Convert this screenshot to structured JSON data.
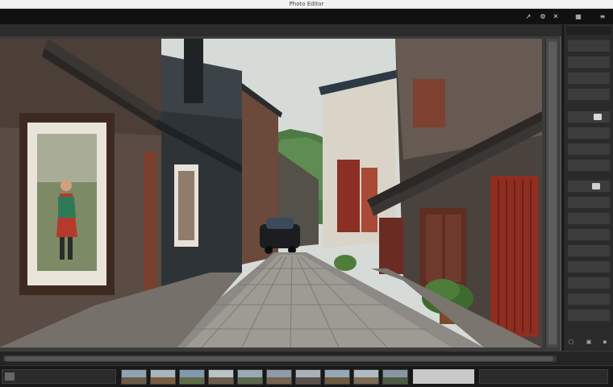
{
  "window": {
    "title": "Photo Editor"
  },
  "menubar": {
    "items": [],
    "controls": [
      "arrow-icon",
      "settings-icon",
      "close-icon",
      "grid-icon",
      "menu-icon"
    ]
  },
  "toolbar": {
    "items": []
  },
  "filmstrip": {
    "thumbnail_count": 10,
    "thumbnails": [
      {
        "sky": "#8fa3b4",
        "land": "#6b5a46"
      },
      {
        "sky": "#a7b5be",
        "land": "#7a5c3c"
      },
      {
        "sky": "#7f99ad",
        "land": "#5f6b45"
      },
      {
        "sky": "#b9c2c7",
        "land": "#6e5b4b"
      },
      {
        "sky": "#9aa9b3",
        "land": "#58664a"
      },
      {
        "sky": "#8c9ba6",
        "land": "#77624d"
      },
      {
        "sky": "#a8b3b9",
        "land": "#5a5048"
      },
      {
        "sky": "#95a8b6",
        "land": "#6c5a3e"
      },
      {
        "sky": "#b0bcc3",
        "land": "#7b6a50"
      },
      {
        "sky": "#8797a2",
        "land": "#4e5a44"
      }
    ]
  },
  "colors": {
    "app_bg": "#1e1e1e",
    "panel_bg": "#2a2a2a",
    "accent": "#b8b8b8"
  }
}
